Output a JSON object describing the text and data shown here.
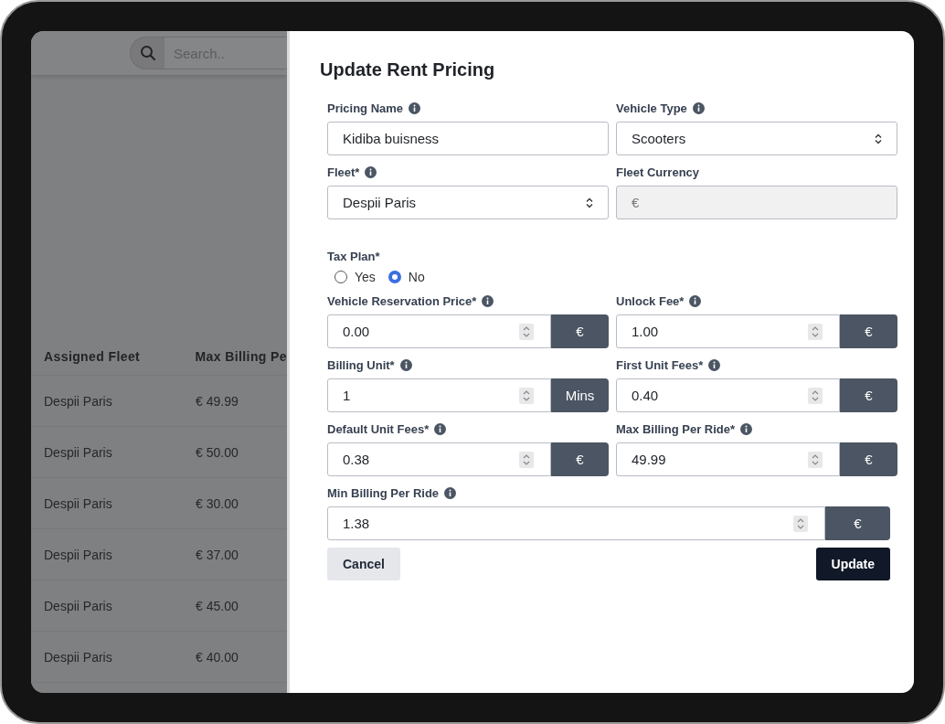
{
  "background": {
    "search": {
      "placeholder": "Search.."
    },
    "table": {
      "columns": [
        "Assigned Fleet",
        "Max Billing Pe"
      ],
      "rows": [
        [
          "Despii Paris",
          "€ 49.99"
        ],
        [
          "Despii Paris",
          "€ 50.00"
        ],
        [
          "Despii Paris",
          "€ 30.00"
        ],
        [
          "Despii Paris",
          "€ 37.00"
        ],
        [
          "Despii Paris",
          "€ 45.00"
        ],
        [
          "Despii Paris",
          "€ 40.00"
        ]
      ]
    }
  },
  "drawer": {
    "title": "Update Rent Pricing",
    "rows": [
      [
        {
          "label": "Pricing Name",
          "info": true,
          "kind": "text",
          "value": "Kidiba buisness"
        },
        {
          "label": "Vehicle Type",
          "info": true,
          "kind": "select",
          "value": "Scooters"
        }
      ],
      [
        {
          "label": "Fleet*",
          "info": true,
          "kind": "select",
          "value": "Despii Paris"
        },
        {
          "label": "Fleet Currency",
          "info": false,
          "kind": "readonly",
          "value": "€"
        }
      ],
      [
        {
          "label": "Tax Plan*",
          "info": false,
          "kind": "radio",
          "options": [
            {
              "label": "Yes",
              "selected": false
            },
            {
              "label": "No",
              "selected": true
            }
          ]
        }
      ],
      [
        {
          "label": "Vehicle Reservation Price*",
          "info": true,
          "kind": "number",
          "value": "0.00",
          "unit": "€"
        },
        {
          "label": "Unlock Fee*",
          "info": true,
          "kind": "number",
          "value": "1.00",
          "unit": "€"
        }
      ],
      [
        {
          "label": "Billing Unit*",
          "info": true,
          "kind": "number",
          "value": "1",
          "unit": "Mins"
        },
        {
          "label": "First Unit Fees*",
          "info": true,
          "kind": "number",
          "value": "0.40",
          "unit": "€"
        }
      ],
      [
        {
          "label": "Default Unit Fees*",
          "info": true,
          "kind": "number",
          "value": "0.38",
          "unit": "€"
        },
        {
          "label": "Max Billing Per Ride*",
          "info": true,
          "kind": "number",
          "value": "49.99",
          "unit": "€"
        }
      ],
      [
        {
          "label": "Min Billing Per Ride",
          "info": true,
          "kind": "number",
          "value": "1.38",
          "unit": "€"
        }
      ]
    ],
    "buttons": [
      {
        "label": "Cancel",
        "kind": "secondary"
      },
      {
        "label": "Update",
        "kind": "primary"
      }
    ]
  }
}
